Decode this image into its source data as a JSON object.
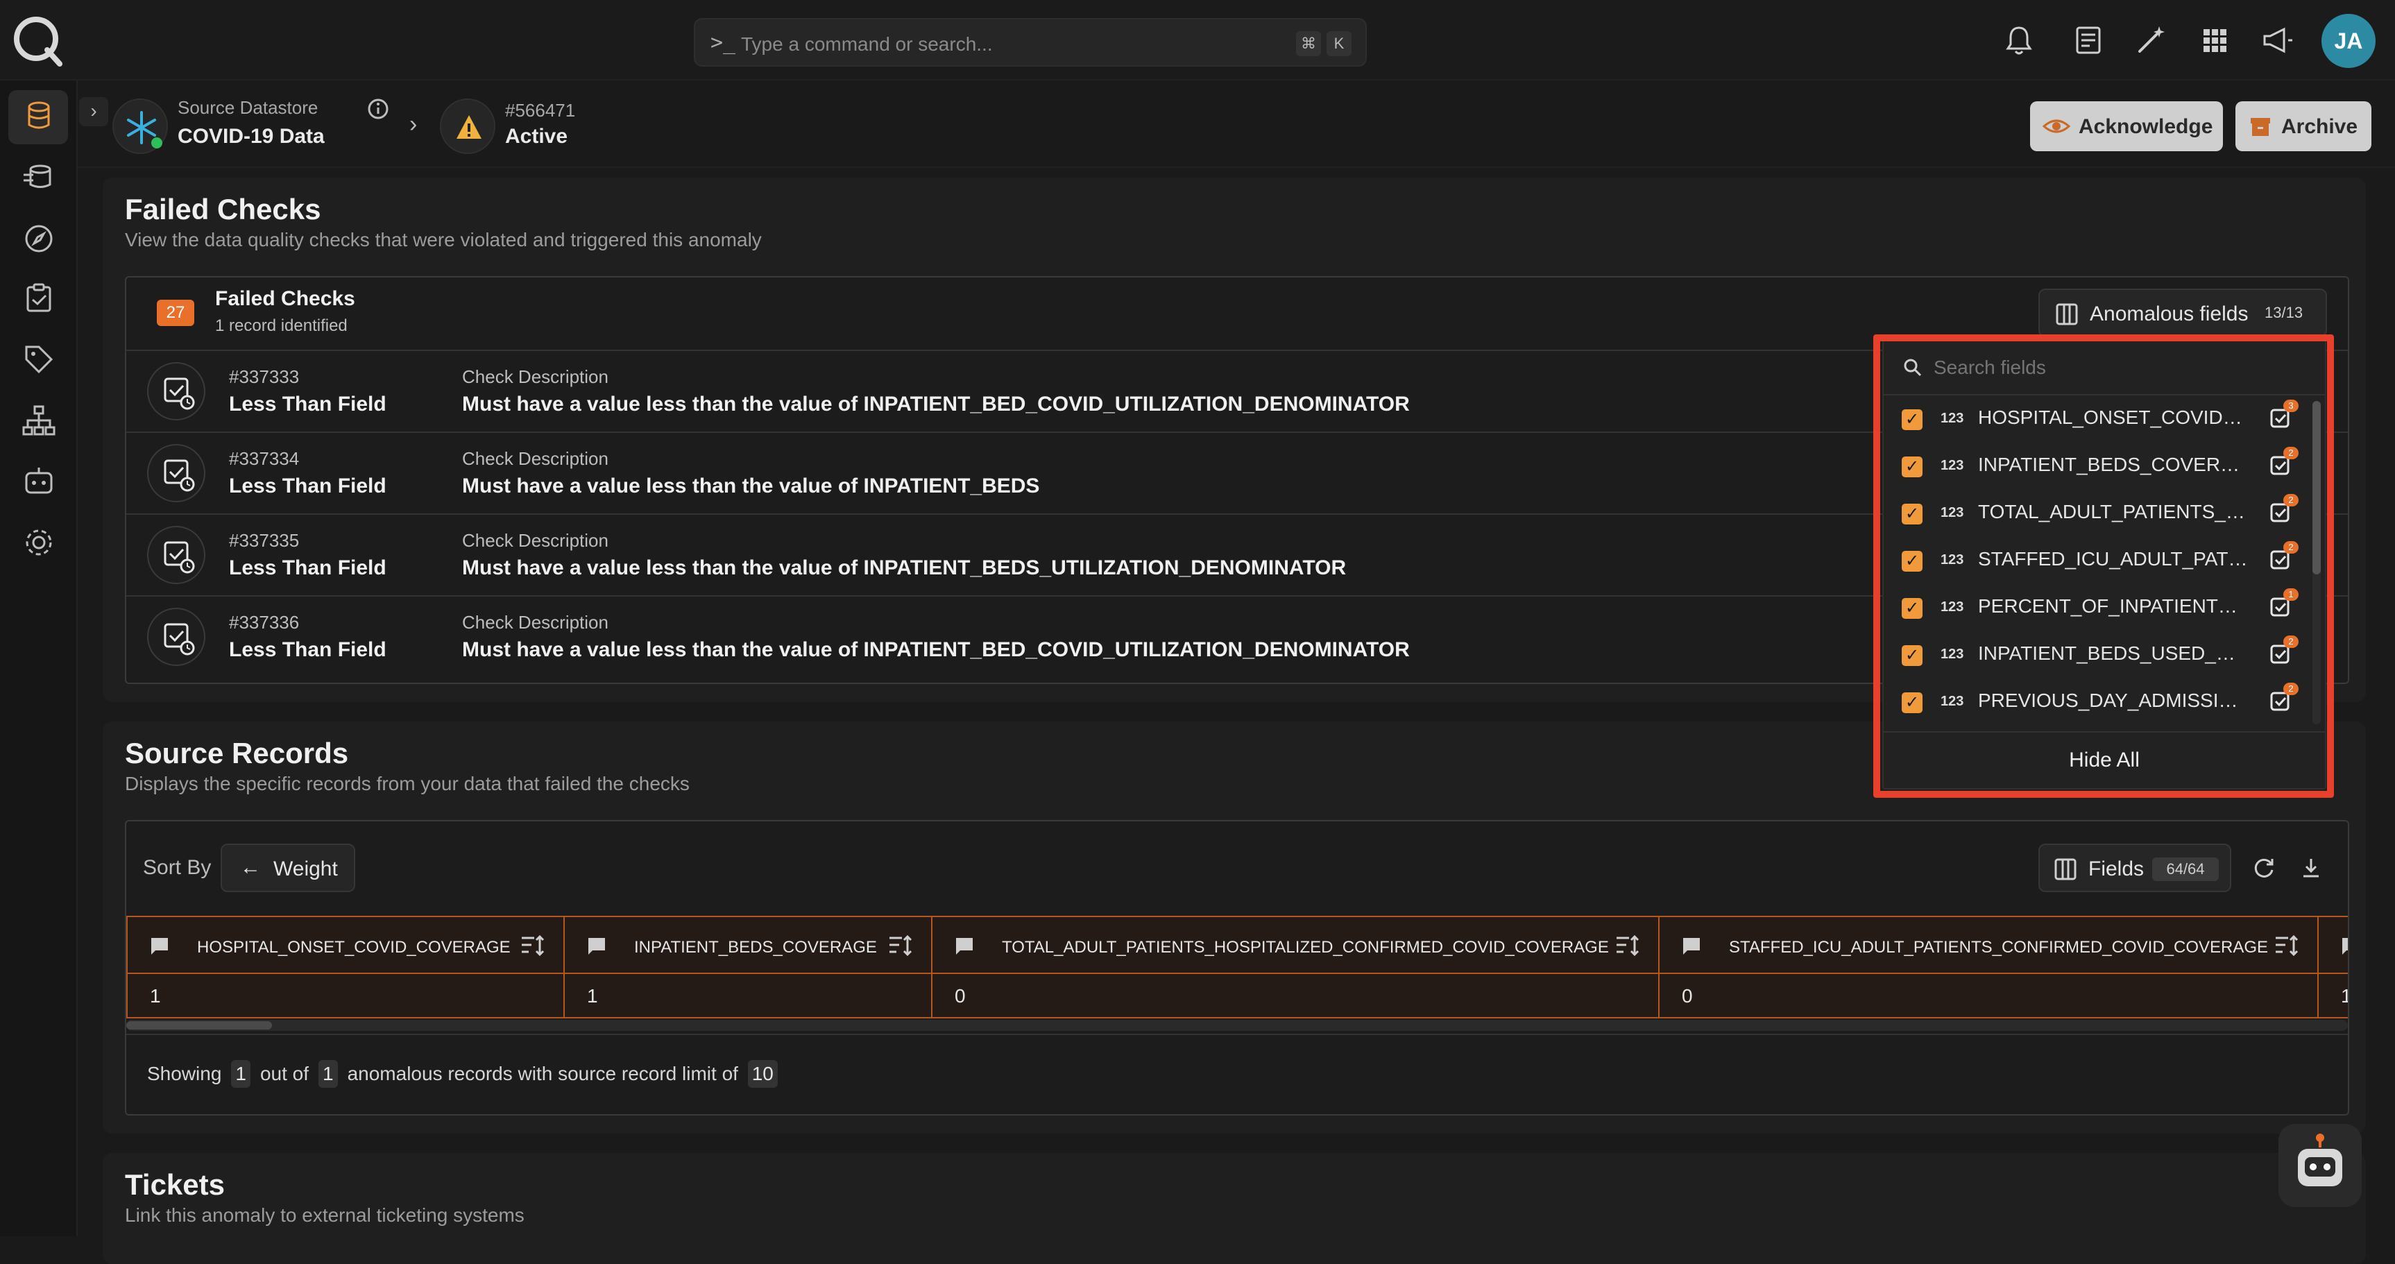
{
  "command_bar": {
    "placeholder": "Type a command or search...",
    "shortcut_mod": "⌘",
    "shortcut_key": "K"
  },
  "user": {
    "initials": "JA"
  },
  "breadcrumb": {
    "datastore_label": "Source Datastore",
    "datastore_name": "COVID-19 Data",
    "anomaly_id": "#566471",
    "anomaly_status": "Active"
  },
  "actions": {
    "acknowledge": "Acknowledge",
    "archive": "Archive"
  },
  "failed_checks_section": {
    "title": "Failed Checks",
    "subtitle": "View the data quality checks that were violated and triggered this anomaly",
    "count": "27",
    "box_title": "Failed Checks",
    "box_subtitle": "1 record identified",
    "anomalous_fields_label": "Anomalous fields",
    "anomalous_fields_count": "13/13",
    "checks": [
      {
        "id": "#337333",
        "name": "Less Than Field",
        "desc_label": "Check Description",
        "desc": "Must have a value less than the value of INPATIENT_BED_COVID_UTILIZATION_DENOMINATOR"
      },
      {
        "id": "#337334",
        "name": "Less Than Field",
        "desc_label": "Check Description",
        "desc": "Must have a value less than the value of INPATIENT_BEDS"
      },
      {
        "id": "#337335",
        "name": "Less Than Field",
        "desc_label": "Check Description",
        "desc": "Must have a value less than the value of INPATIENT_BEDS_UTILIZATION_DENOMINATOR"
      },
      {
        "id": "#337336",
        "name": "Less Than Field",
        "desc_label": "Check Description",
        "desc": "Must have a value less than the value of INPATIENT_BED_COVID_UTILIZATION_DENOMINATOR"
      }
    ]
  },
  "fields_dropdown": {
    "search_placeholder": "Search fields",
    "type_glyph": "123",
    "hide_all": "Hide All",
    "fields": [
      {
        "name": "HOSPITAL_ONSET_COVID_COVERAGE",
        "badge": "3"
      },
      {
        "name": "INPATIENT_BEDS_COVERAGE",
        "badge": "2"
      },
      {
        "name": "TOTAL_ADULT_PATIENTS_HOSPITALIZED_CONFIRMED_COVID_COVERAGE",
        "badge": "2"
      },
      {
        "name": "STAFFED_ICU_ADULT_PATIENTS_CONFIRMED_COVID_COVERAGE",
        "badge": "2"
      },
      {
        "name": "PERCENT_OF_INPATIENTS_WITH_COVID",
        "badge": "1"
      },
      {
        "name": "INPATIENT_BEDS_USED_COVID_COVERAGE",
        "badge": "2"
      },
      {
        "name": "PREVIOUS_DAY_ADMISSION_ADULT_COVID_CONFIRMED",
        "badge": "2"
      }
    ]
  },
  "source_records_section": {
    "title": "Source Records",
    "subtitle": "Displays the specific records from your data that failed the checks",
    "sort_by_label": "Sort By",
    "sort_value": "Weight",
    "fields_label": "Fields",
    "fields_count": "64/64",
    "columns": [
      {
        "name": "HOSPITAL_ONSET_COVID_COVERAGE",
        "value": "1"
      },
      {
        "name": "INPATIENT_BEDS_COVERAGE",
        "value": "1"
      },
      {
        "name": "TOTAL_ADULT_PATIENTS_HOSPITALIZED_CONFIRMED_COVID_COVERAGE",
        "value": "0"
      },
      {
        "name": "STAFFED_ICU_ADULT_PATIENTS_CONFIRMED_COVID_COVERAGE",
        "value": "0"
      },
      {
        "name": "",
        "value": "1"
      }
    ],
    "footer": {
      "showing": "Showing",
      "shown": "1",
      "out_of": "out of",
      "total": "1",
      "middle": "anomalous records with source record limit of",
      "limit": "10"
    }
  },
  "tickets_section": {
    "title": "Tickets",
    "subtitle": "Link this anomaly to external ticketing systems"
  }
}
